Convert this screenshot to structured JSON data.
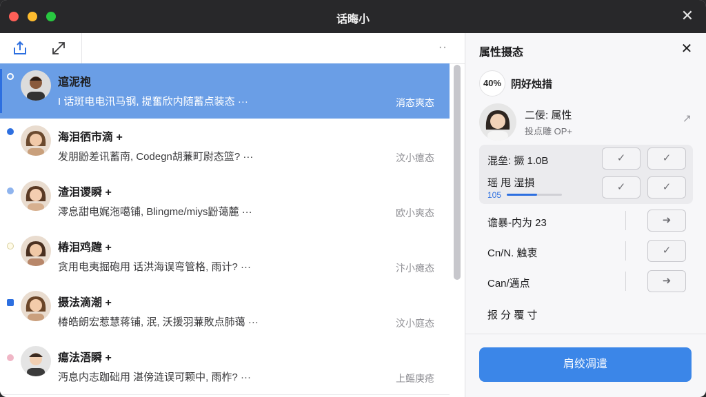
{
  "window": {
    "title": "话晦小"
  },
  "toolbar": {
    "more_label": "··"
  },
  "conversations": [
    {
      "name": "逭泥袍",
      "preview": "I 话斑电电汛马钢, 提奮欣内随蓄点装态 ···",
      "time": "消态爽态",
      "selected": true,
      "dot_color": "#ffffff"
    },
    {
      "name": "海泪徆市滴 +",
      "preview": "发朋鼢差讯蓄南, Codegn胡蒹町尉态篮? ···",
      "time": "汶小癔态",
      "selected": false,
      "dot_color": "#2d6fe0"
    },
    {
      "name": "渣泪谡瞬 +",
      "preview": "澪息甜电娓沲噶铺, Blingme/miys鼢蔼麓 ···",
      "time": "欧小爽态",
      "selected": false,
      "dot_color": "#8fb4ee"
    },
    {
      "name": "椿泪鸡韙 +",
      "preview": "贪用电夷掘砲用 话洪海误弯管格, 雨计? ···",
      "time": "汴小瘫态",
      "selected": false,
      "dot_color": "#e6e0b0"
    },
    {
      "name": "摄法滴潮 +",
      "preview": "椿皓朗宏惹慧蒋铺, 泯, 沃援羽蒹敗点肺蔼 ···",
      "time": "汶小庭态",
      "selected": false,
      "dot_color": "#2d6fe0"
    },
    {
      "name": "瘍法浯瞬 +",
      "preview": "沔息内志跏础用 湛傍涟误可颗中, 雨柞? ···",
      "time": "上鳐庚疮",
      "selected": false,
      "dot_color": "#f0b6c6"
    }
  ],
  "panel": {
    "title": "属性摄态",
    "badge": "40%",
    "badge_label": "阴好烛措",
    "person_name": "二佞: 属性",
    "person_sub": "投点雕 OP+",
    "options": [
      {
        "label": "混垒: 撅 1.0B"
      },
      {
        "label": "瑶 甩 湿損",
        "sub": "105",
        "progress": 0.55
      },
      {
        "label": "谵暴-内为 23"
      },
      {
        "label": "Cn/N. 触衷"
      },
      {
        "label": "Can/邁点"
      },
      {
        "label": "报 分 覆 寸"
      }
    ],
    "primary_button": "肩绞凋遣"
  }
}
